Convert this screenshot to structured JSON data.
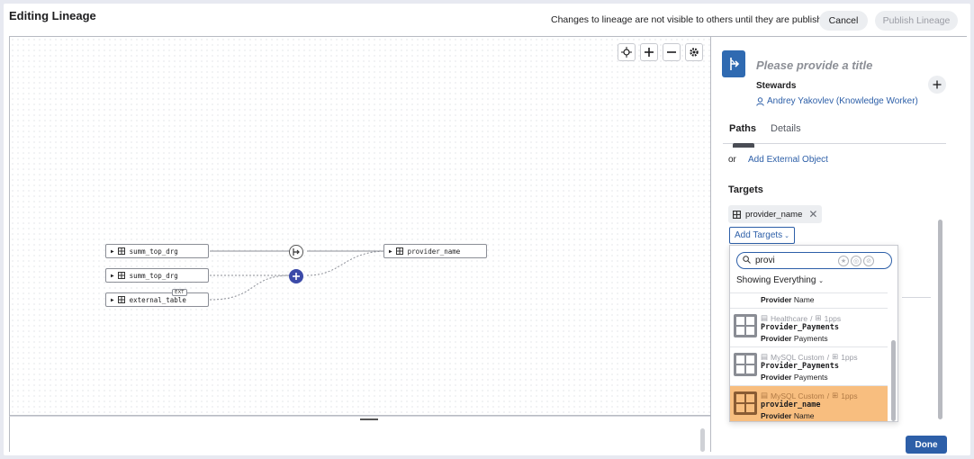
{
  "header": {
    "title": "Editing Lineage",
    "notice": "Changes to lineage are not visible to others until they are published",
    "cancel_label": "Cancel",
    "publish_label": "Publish Lineage"
  },
  "canvas_controls": [
    "recenter-icon",
    "zoom-in-icon",
    "zoom-out-icon",
    "settings-icon"
  ],
  "graph": {
    "nodes": [
      {
        "label": "summ_top_drg"
      },
      {
        "label": "summ_top_drg"
      },
      {
        "label": "external_table",
        "tag": "EXT"
      },
      {
        "label": "provider_name"
      }
    ]
  },
  "panel": {
    "title_placeholder": "Please provide a title",
    "stewards_label": "Stewards",
    "steward_name": "Andrey Yakovlev (Knowledge Worker)",
    "tabs": [
      {
        "label": "Paths",
        "active": true
      },
      {
        "label": "Details",
        "active": false
      }
    ],
    "or_text": "or",
    "add_external": "Add External Object",
    "targets_label": "Targets",
    "target_chip": "provider_name",
    "add_targets": "Add Targets",
    "done_label": "Done"
  },
  "dropdown": {
    "search_value": "provi",
    "showing": "Showing Everything",
    "results": [
      {
        "source": "",
        "schema": "",
        "name": "",
        "desc_bold": "Provider",
        "desc_rest": " Name",
        "selected": false
      },
      {
        "source": "Healthcare",
        "schema": "1pps",
        "name": "Provider_Payments",
        "desc_bold": "Provider",
        "desc_rest": " Payments",
        "selected": false
      },
      {
        "source": "MySQL Custom",
        "schema": "1pps",
        "name": "Provider_Payments",
        "desc_bold": "Provider",
        "desc_rest": " Payments",
        "selected": false
      },
      {
        "source": "MySQL Custom",
        "schema": "1pps",
        "name": "provider_name",
        "desc_bold": "Provider",
        "desc_rest": " Name",
        "selected": true
      }
    ]
  },
  "colors": {
    "primary": "#2d5fa8",
    "selected_row": "#f8be7f",
    "add_node": "#3b4aa8"
  }
}
